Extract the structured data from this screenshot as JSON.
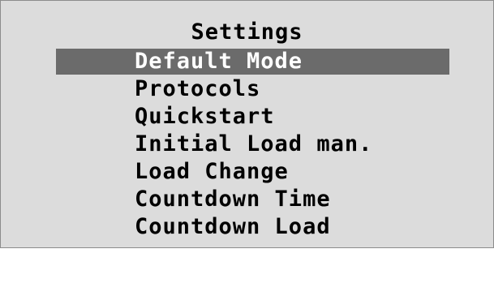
{
  "screen": {
    "title": "Settings",
    "colors": {
      "background": "#dcdcdc",
      "highlight": "#6b6b6b",
      "text": "#000000",
      "selected_text": "#ffffff"
    },
    "menu": {
      "selected_index": 0,
      "items": [
        {
          "label": "Default Mode"
        },
        {
          "label": "Protocols"
        },
        {
          "label": "Quickstart"
        },
        {
          "label": "Initial Load man."
        },
        {
          "label": "Load Change"
        },
        {
          "label": "Countdown Time"
        },
        {
          "label": "Countdown Load"
        }
      ]
    }
  }
}
